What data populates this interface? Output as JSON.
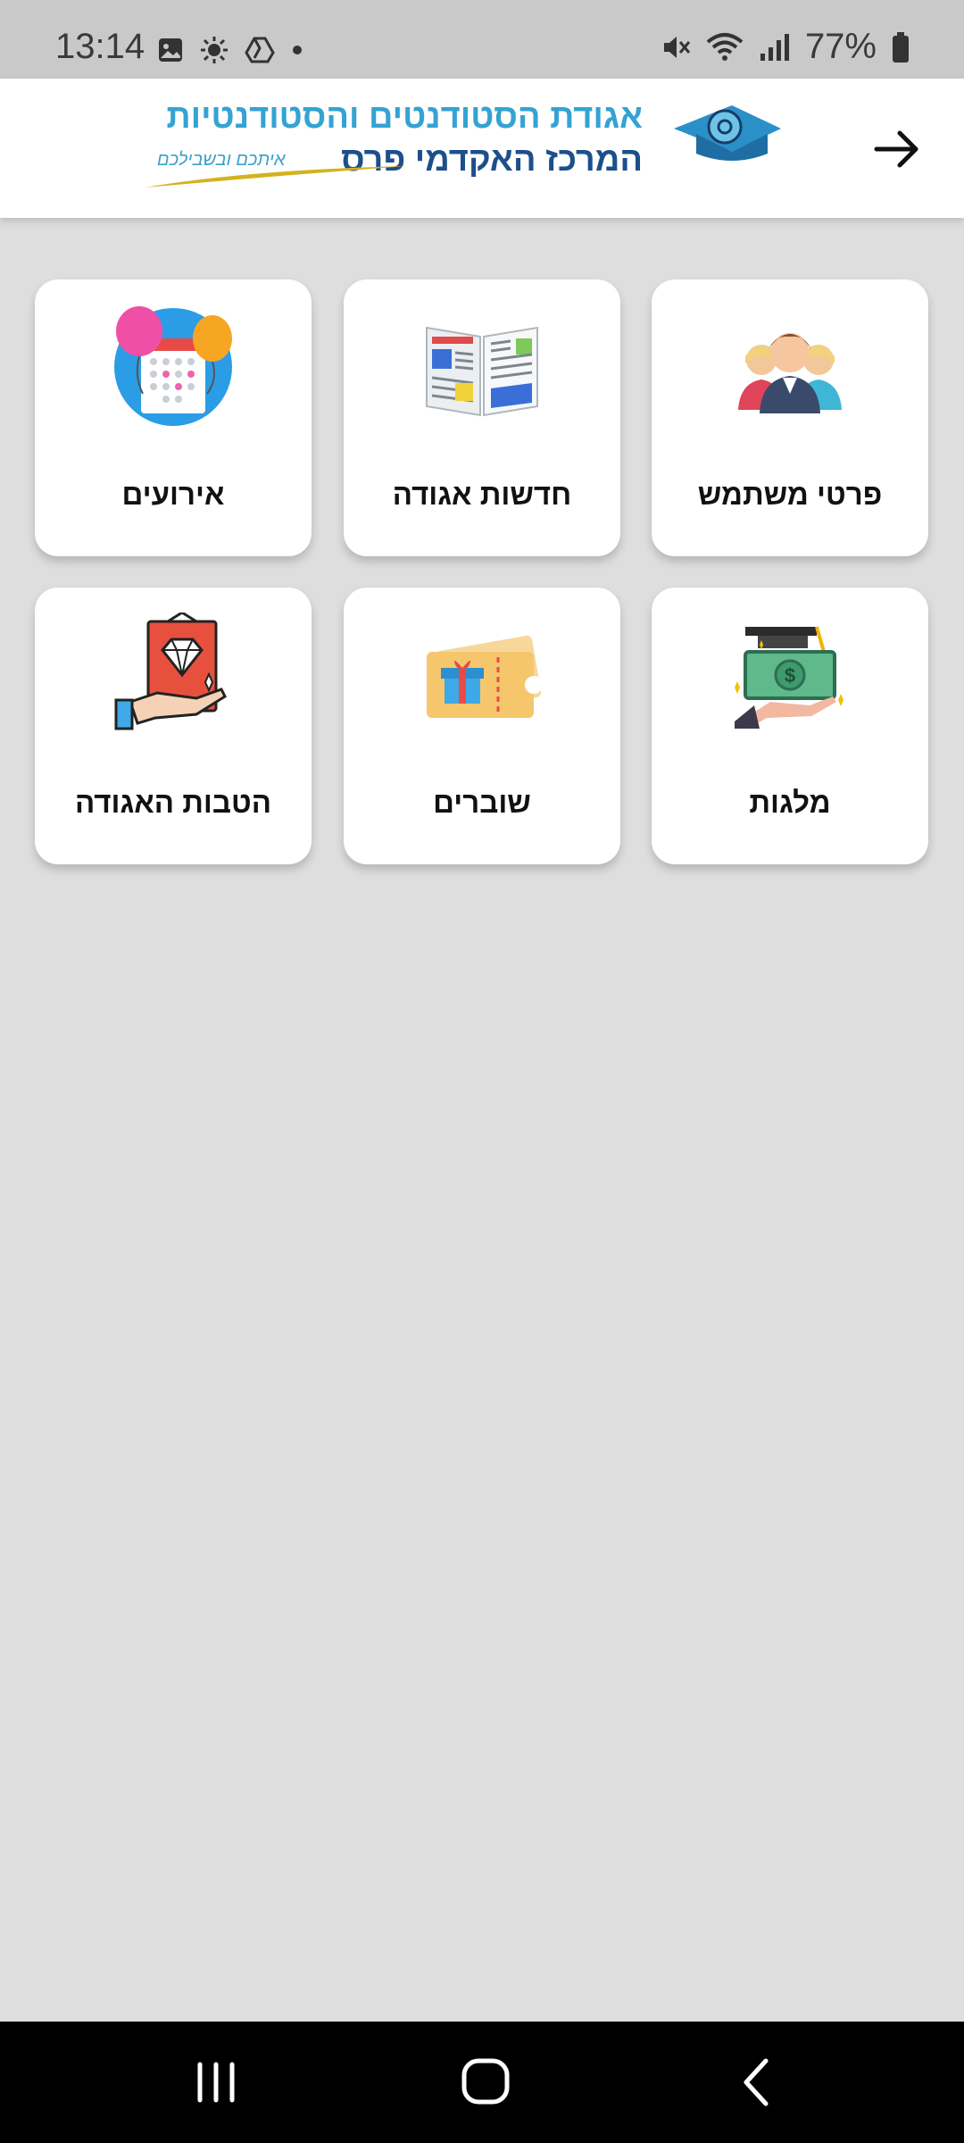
{
  "status_bar": {
    "time": "13:14",
    "battery": "77%",
    "left_icons": [
      "image-icon",
      "brightness-icon",
      "drive-icon",
      "dot-icon"
    ],
    "right_icons": [
      "mute-icon",
      "wifi-icon",
      "signal-icon",
      "battery-icon"
    ]
  },
  "header": {
    "logo_line1": "אגודת הסטודנטים והסטודנטיות",
    "logo_line2": "המרכז האקדמי פרס",
    "logo_tagline": "איתכם ובשבילכם",
    "back_icon": "arrow-right-icon"
  },
  "tiles": [
    {
      "label": "פרטי משתמש",
      "icon": "users-icon"
    },
    {
      "label": "חדשות  אגודה",
      "icon": "newspaper-icon"
    },
    {
      "label": "אירועים",
      "icon": "calendar-balloons-icon"
    },
    {
      "label": "מלגות",
      "icon": "scholarship-money-icon"
    },
    {
      "label": "שוברים",
      "icon": "voucher-gift-icon"
    },
    {
      "label": "הטבות האגודה",
      "icon": "benefits-diamond-icon"
    }
  ],
  "colors": {
    "background": "#dedede",
    "header_bg": "#ffffff",
    "logo_light_blue": "#34a3d3",
    "logo_dark_blue": "#1d4f8a",
    "status_bar_bg": "#c9c9c9",
    "nav_bar_bg": "#000000"
  },
  "nav_bar": {
    "buttons": [
      "recent-apps-icon",
      "home-icon",
      "back-icon"
    ]
  }
}
